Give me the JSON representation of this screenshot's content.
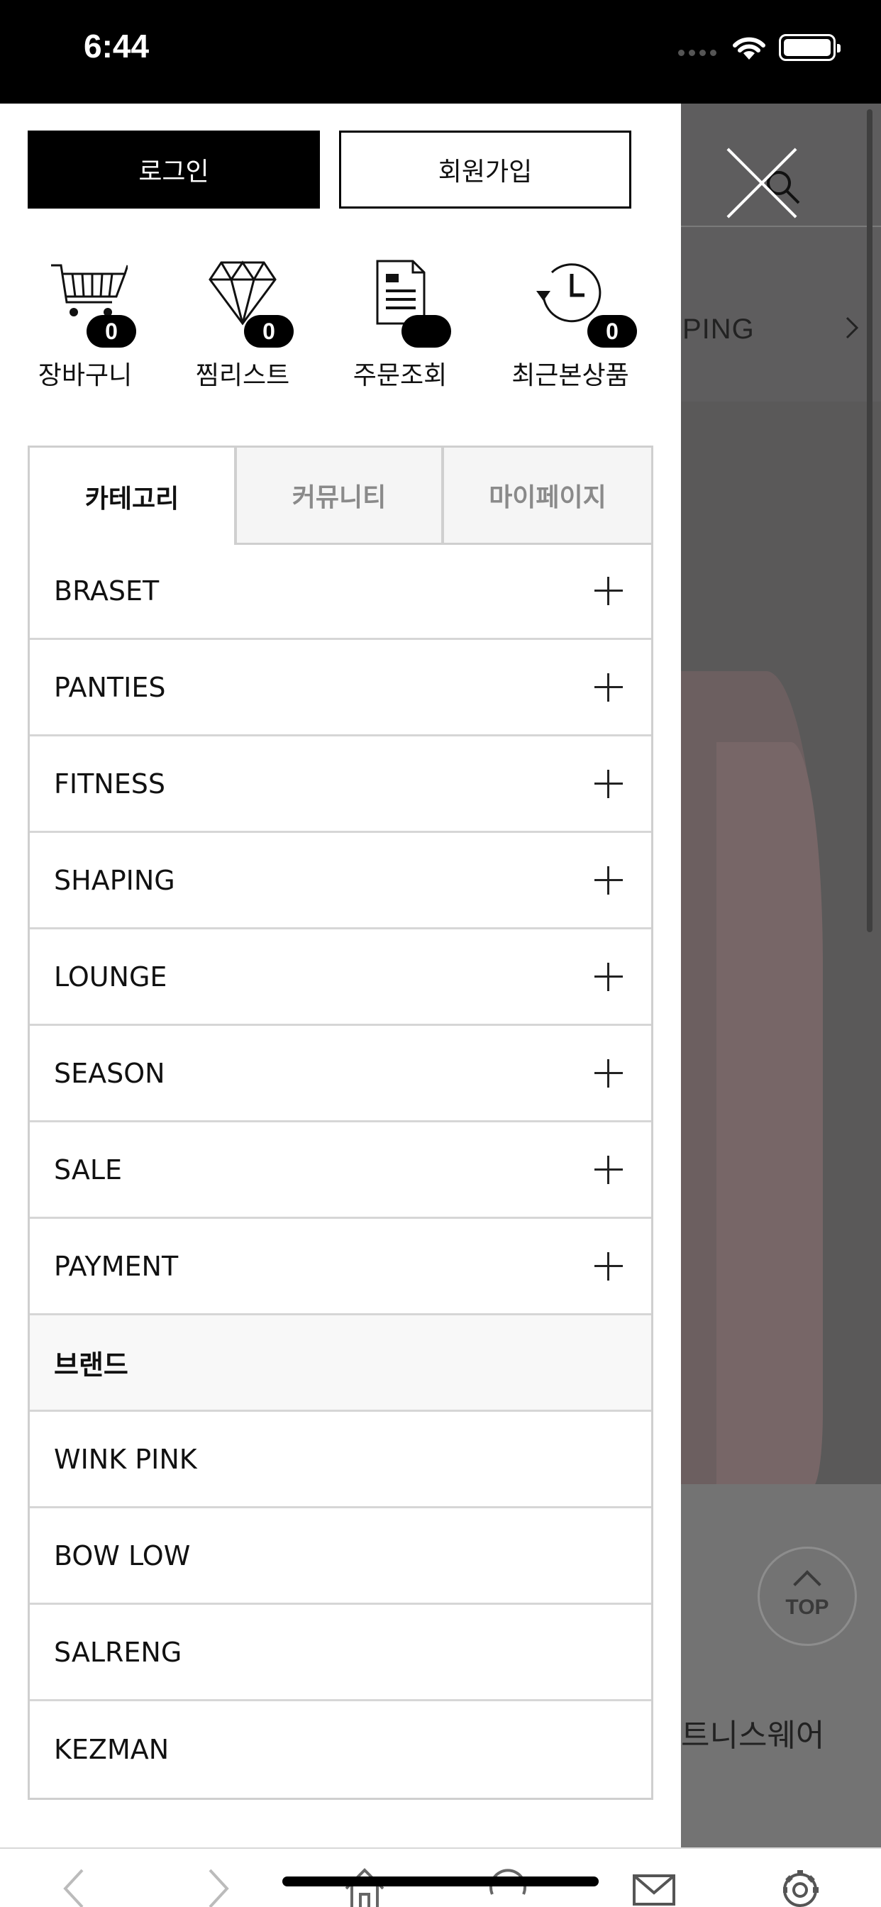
{
  "status_bar": {
    "time": "6:44"
  },
  "background_page": {
    "nav_text": "PING",
    "top_button_label": "TOP",
    "snippet_text": "트니스웨어"
  },
  "drawer": {
    "login_label": "로그인",
    "join_label": "회원가입",
    "quick_links": [
      {
        "label": "장바구니",
        "badge": "0",
        "icon": "cart-icon"
      },
      {
        "label": "찜리스트",
        "badge": "0",
        "icon": "diamond-icon"
      },
      {
        "label": "주문조회",
        "badge": "",
        "icon": "document-icon"
      },
      {
        "label": "최근본상품",
        "badge": "0",
        "icon": "history-icon"
      }
    ],
    "tabs": [
      "카테고리",
      "커뮤니티",
      "마이페이지"
    ],
    "categories": [
      "BRASET",
      "PANTIES",
      "FITNESS",
      "SHAPING",
      "LOUNGE",
      "SEASON",
      "SALE",
      "PAYMENT"
    ],
    "brand_header": "브랜드",
    "brands": [
      "WINK PINK",
      "BOW LOW",
      "SALRENG",
      "KEZMAN"
    ]
  },
  "toolbar": {
    "icons": [
      "back-arrow-icon",
      "forward-arrow-icon",
      "home-icon",
      "refresh-icon",
      "mail-icon",
      "settings-gear-icon"
    ]
  }
}
